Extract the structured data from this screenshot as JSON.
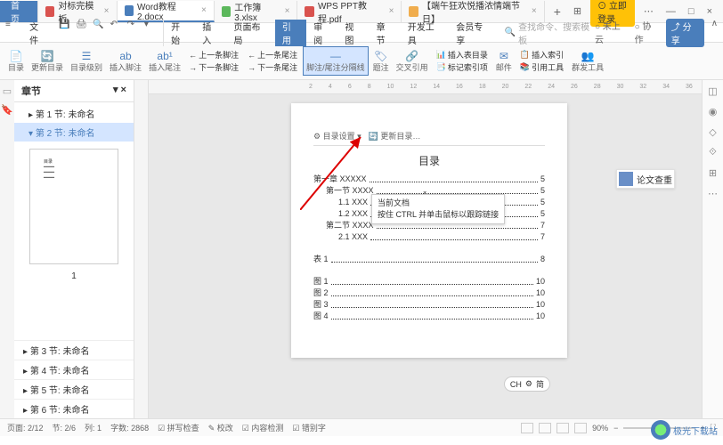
{
  "titlebar": {
    "home": "首页",
    "tabs": [
      {
        "icon": "red",
        "label": "对标完模板"
      },
      {
        "icon": "blue",
        "label": "Word教程2.docx",
        "active": true
      },
      {
        "icon": "green",
        "label": "工作簿3.xlsx"
      },
      {
        "icon": "red",
        "label": "WPS PPT教程.pdf"
      },
      {
        "icon": "orange",
        "label": "【端午狂欢悦播浓情端节日】"
      }
    ],
    "login": "立即登录"
  },
  "menubar": {
    "file": "文件",
    "items": [
      "开始",
      "插入",
      "页面布局",
      "引用",
      "审阅",
      "视图",
      "章节",
      "开发工具",
      "会员专享"
    ],
    "active_index": 3,
    "search_placeholder": "查找命令、搜索模板",
    "right": [
      "未上云",
      "协作",
      "分享"
    ]
  },
  "ribbon": {
    "groups": [
      {
        "label": "目录"
      },
      {
        "label": "更新目录"
      },
      {
        "label": "目录级别"
      }
    ],
    "insert_footnote": "插入脚注",
    "insert_endnote": "插入尾注",
    "prev_endnote": "上一条尾注",
    "next_endnote": "下一条尾注",
    "prev_footnote": "上一条脚注",
    "next_footnote": "下一条脚注",
    "footnote_separator": "脚注/尾注分隔线",
    "caption": "题注",
    "cross_ref": "交叉引用",
    "insert_table": "插入表目录",
    "mark_entry": "标记索引项",
    "mailings": "邮件",
    "insert_index": "插入索引",
    "ref_tools": "引用工具",
    "group_tools": "群发工具"
  },
  "sidebar": {
    "title": "章节",
    "sections": [
      "第 1 节: 未命名",
      "第 2 节: 未命名",
      "第 3 节: 未命名",
      "第 4 节: 未命名",
      "第 5 节: 未命名",
      "第 6 节: 未命名"
    ],
    "thumb_page": "1"
  },
  "page": {
    "toc_settings": "目录设置",
    "update_toc": "更新目录…",
    "toc_title": "目录",
    "entries": [
      {
        "level": 1,
        "text": "第一章 XXXXX",
        "page": "5"
      },
      {
        "level": 2,
        "text": "第一节 XXXX",
        "page": "5"
      },
      {
        "level": 3,
        "text": "1.1 XXX",
        "page": "5"
      },
      {
        "level": 3,
        "text": "1.2 XXX",
        "page": "5"
      },
      {
        "level": 2,
        "text": "第二节 XXXX",
        "page": "7"
      },
      {
        "level": 3,
        "text": "2.1 XXX",
        "page": "7"
      }
    ],
    "tables": [
      {
        "text": "表 1",
        "page": "8"
      }
    ],
    "figures": [
      {
        "text": "图 1",
        "page": "10"
      },
      {
        "text": "图 2",
        "page": "10"
      },
      {
        "text": "图 3",
        "page": "10"
      },
      {
        "text": "图 4",
        "page": "10"
      }
    ]
  },
  "tooltip": {
    "line1": "当前文档",
    "line2": "按住 CTRL 并单击鼠标以跟踪链接"
  },
  "float_tool": "论文查重",
  "ch_badge": {
    "left": "CH",
    "right": "简"
  },
  "statusbar": {
    "page": "页面: 2/12",
    "section": "节: 2/6",
    "col": "列: 1",
    "words": "字数: 2868",
    "spell": "拼写检查",
    "revise": "校改",
    "content": "内容检测",
    "typo": "错别字",
    "zoom": "90%"
  },
  "watermark": "极光下载站"
}
